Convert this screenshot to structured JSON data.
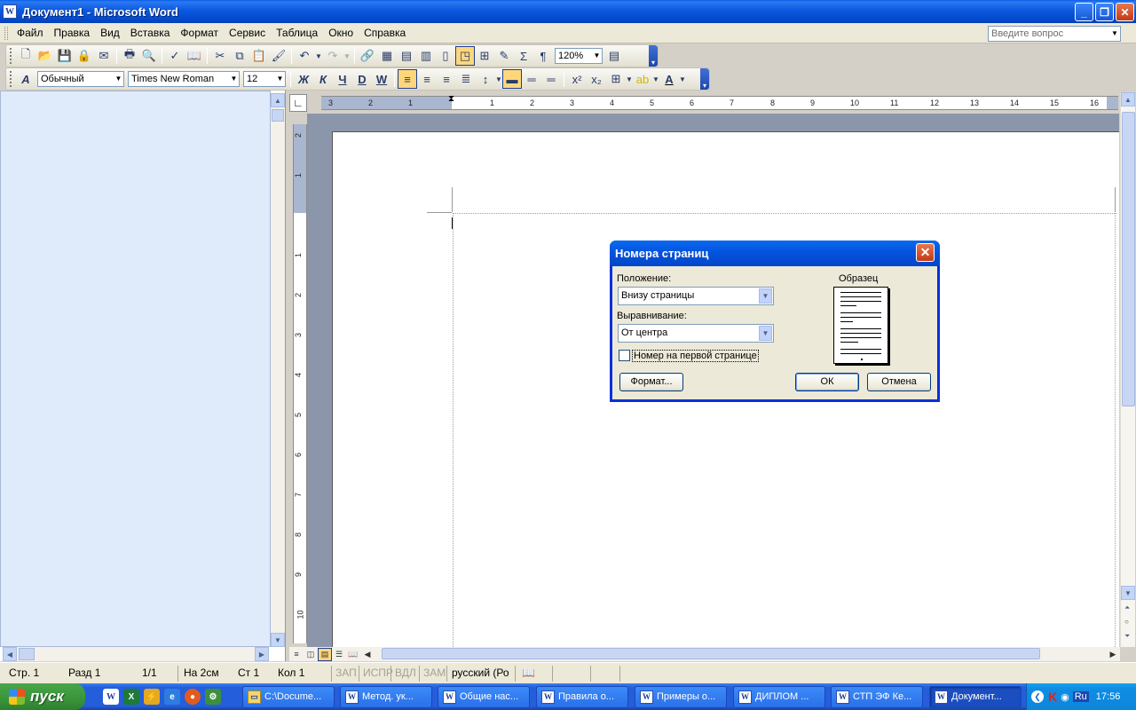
{
  "window": {
    "title": "Документ1 - Microsoft Word",
    "app_icon": "W"
  },
  "menu": {
    "items": [
      "Файл",
      "Правка",
      "Вид",
      "Вставка",
      "Формат",
      "Сервис",
      "Таблица",
      "Окно",
      "Справка"
    ],
    "ask_placeholder": "Введите вопрос"
  },
  "standard_toolbar": {
    "zoom": "120%"
  },
  "formatting_toolbar": {
    "style": "Обычный",
    "font": "Times New Roman",
    "size": "12",
    "bold": "Ж",
    "italic": "К",
    "underline": "Ч",
    "bold2": "D",
    "word_art": "W"
  },
  "ruler": {
    "h_left_labels": [
      "3",
      "2",
      "1"
    ],
    "h_right_labels": [
      "1",
      "2",
      "3",
      "4",
      "5",
      "6",
      "7",
      "8",
      "9",
      "10",
      "11",
      "12",
      "13",
      "14",
      "15",
      "16"
    ],
    "v_top_labels": [
      "2",
      "1"
    ],
    "v_labels": [
      "1",
      "2",
      "3",
      "4",
      "5",
      "6",
      "7",
      "8",
      "9",
      "10"
    ]
  },
  "dialog": {
    "title": "Номера страниц",
    "position_label": "Положение:",
    "position_value": "Внизу страницы",
    "alignment_label": "Выравнивание:",
    "alignment_value": "От центра",
    "first_page_label": "Номер на первой странице",
    "first_page_checked": false,
    "sample_label": "Образец",
    "format_button": "Формат...",
    "ok_button": "ОК",
    "cancel_button": "Отмена"
  },
  "status": {
    "page": "Стр. 1",
    "section": "Разд 1",
    "pages": "1/1",
    "at": "На 2см",
    "line": "Ст 1",
    "col": "Кол 1",
    "rec": "ЗАП",
    "trk": "ИСПР",
    "ext": "ВДЛ",
    "ovr": "ЗАМ",
    "lang": "русский (Ро"
  },
  "taskbar": {
    "start_label": "пуск",
    "tasks": [
      "C:\\Docume...",
      "Метод. ук...",
      "Общие нас...",
      "Правила о...",
      "Примеры о...",
      "ДИПЛОМ ...",
      "СТП ЭФ Ке...",
      "Документ..."
    ],
    "lang": "Ru",
    "clock": "17:56"
  },
  "colors": {
    "title_blue": "#0a5ee8",
    "dialog_border": "#0831d9",
    "task_pane": "#dfebfb"
  }
}
